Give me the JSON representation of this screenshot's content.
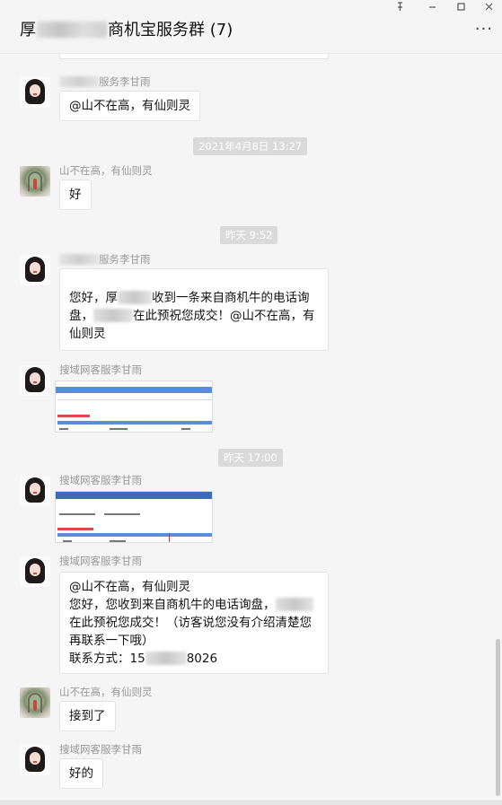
{
  "window": {
    "title_prefix": "厚",
    "title_suffix": "商机宝服务群 (7)",
    "pin_icon": "pin-icon",
    "minimize_icon": "minimize-icon",
    "maximize_icon": "maximize-icon",
    "close_icon": "close-icon",
    "more_label": "···"
  },
  "messages": [
    {
      "sender": "服务李甘雨",
      "text": "@山不在高，有仙则灵"
    },
    {
      "time": "2021年4月8日 13:27"
    },
    {
      "sender": "山不在高，有仙则灵",
      "text": "好"
    },
    {
      "time": "昨天 9:52"
    },
    {
      "sender": "服务李甘雨",
      "text_parts": [
        "您好，厚",
        "收到一条来自商机牛的电话询盘，",
        "在此预祝您成交！@山不在高，有仙则灵"
      ]
    },
    {
      "sender": "搜域网客服李甘雨",
      "image": "screenshot-image"
    },
    {
      "time": "昨天 17:00"
    },
    {
      "sender": "搜域网客服李甘雨",
      "image": "screenshot-image"
    },
    {
      "sender": "搜域网客服李甘雨",
      "text_parts": [
        "@山不在高，有仙则灵",
        "您好，您收到来自商机牛的电话询盘，",
        "在此预祝您成交！（访客说您没有介绍清楚您再联系一下哦）",
        "联系方式：15",
        "8026"
      ]
    },
    {
      "sender": "山不在高，有仙则灵",
      "text": "接到了"
    },
    {
      "sender": "搜域网客服李甘雨",
      "text": "好的"
    }
  ],
  "colors": {
    "background": "#f5f5f5",
    "bubble": "#ffffff",
    "time_pill": "#dadada",
    "sender_text": "#999999"
  }
}
